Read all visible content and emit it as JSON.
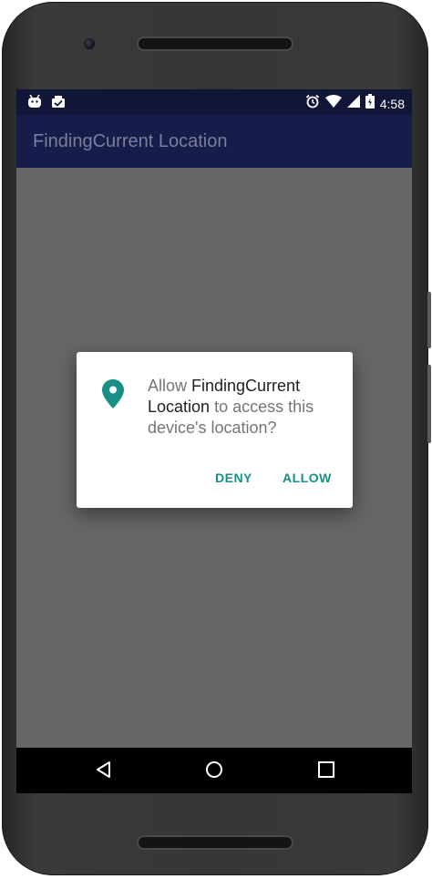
{
  "status_bar": {
    "time": "4:58",
    "left_icons": [
      "android-icon",
      "clipboard-check-icon"
    ],
    "right_icons": [
      "alarm-icon",
      "wifi-icon",
      "signal-icon",
      "battery-icon"
    ]
  },
  "app_bar": {
    "title": "FindingCurrent Location"
  },
  "dialog": {
    "icon": "location-pin-icon",
    "message_prefix": "Allow ",
    "app_name": "FindingCurrent Location",
    "message_suffix": " to access this device's location?",
    "deny_label": "DENY",
    "allow_label": "ALLOW"
  },
  "nav_bar": {
    "icons": [
      "back-icon",
      "home-icon",
      "recents-icon"
    ]
  },
  "colors": {
    "status_bar": "#111639",
    "app_bar": "#161d4b",
    "scrim": "#666666",
    "accent": "#178f85"
  }
}
